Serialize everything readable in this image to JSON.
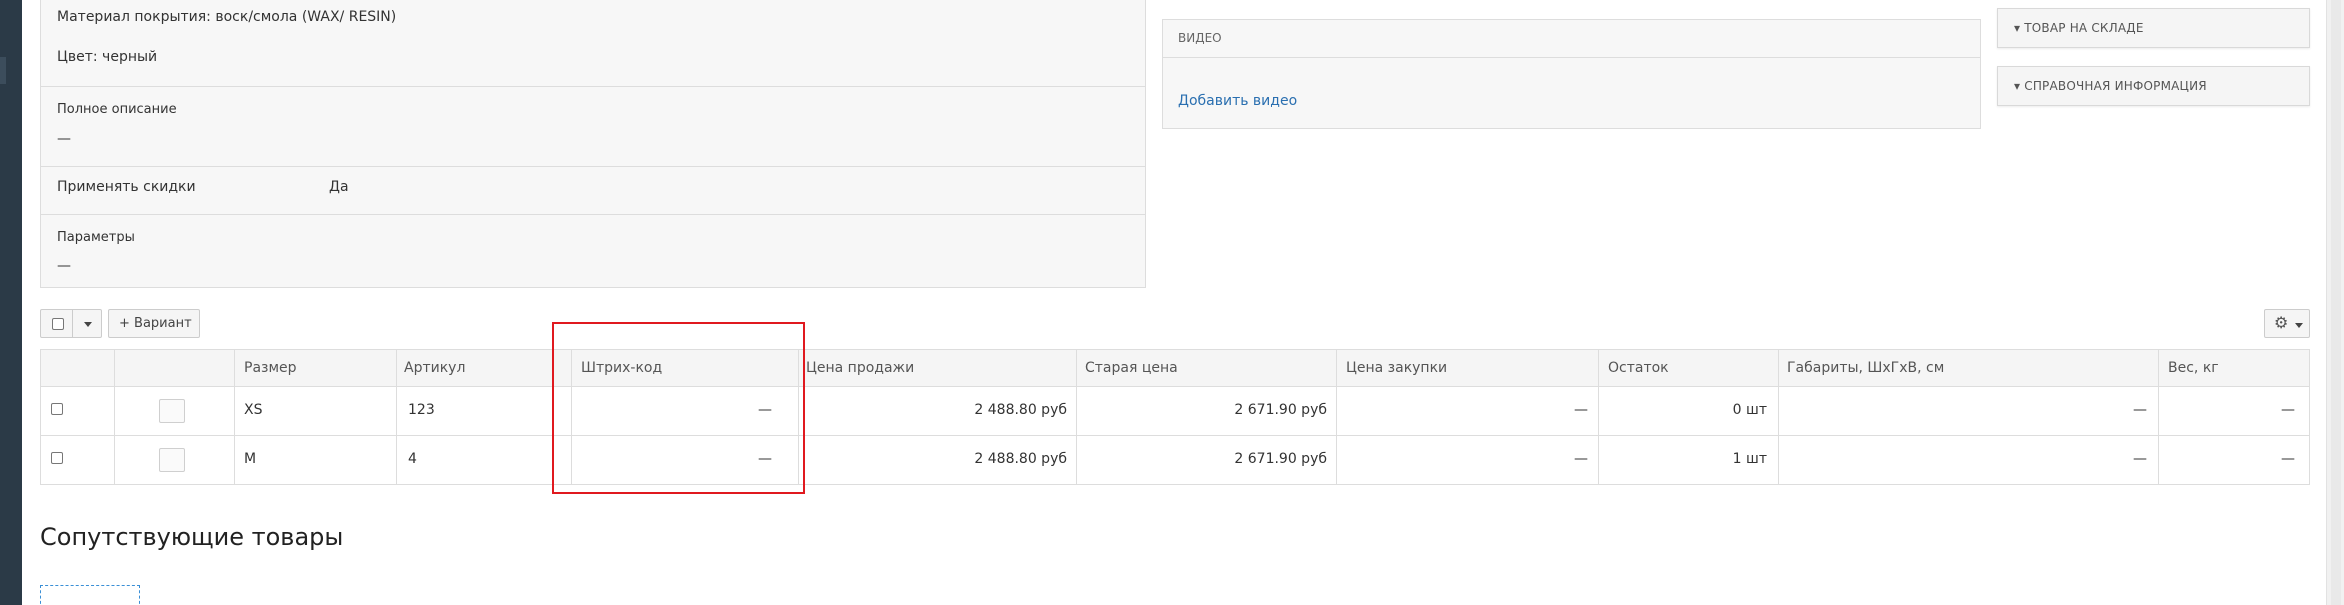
{
  "product_info": {
    "material": "Материал покрытия: воск/смола (WAX/ RESIN)",
    "color": "Цвет: черный",
    "full_description_label": "Полное описание",
    "full_description_value": "—",
    "discounts_label": "Применять скидки",
    "discounts_value": "Да",
    "params_label": "Параметры",
    "params_value": "—"
  },
  "video": {
    "title": "ВИДЕО",
    "add_link": "Добавить видео"
  },
  "side_panels": {
    "stock": "▾ ТОВАР НА СКЛАДЕ",
    "reference": "▾ СПРАВОЧНАЯ ИНФОРМАЦИЯ"
  },
  "toolbar": {
    "add_variant": "+ Вариант"
  },
  "table": {
    "headers": [
      "Размер",
      "Артикул",
      "Штрих-код",
      "Цена продажи",
      "Старая цена",
      "Цена закупки",
      "Остаток",
      "Габариты, ШхГхВ, см",
      "Вес, кг"
    ],
    "rows": [
      {
        "size": "XS",
        "article": "123",
        "barcode": "—",
        "price": "2 488.80 руб",
        "old_price": "2 671.90 руб",
        "purchase": "—",
        "stock": "0 шт",
        "dims": "—",
        "weight": "—"
      },
      {
        "size": "M",
        "article": "4",
        "barcode": "—",
        "price": "2 488.80 руб",
        "old_price": "2 671.90 руб",
        "purchase": "—",
        "stock": "1 шт",
        "dims": "—",
        "weight": "—"
      }
    ]
  },
  "related": {
    "title": "Сопутствующие товары"
  },
  "colors": {
    "highlight": "#e0191f",
    "link": "#2a6fb0",
    "sidebar": "#2b3a47"
  }
}
